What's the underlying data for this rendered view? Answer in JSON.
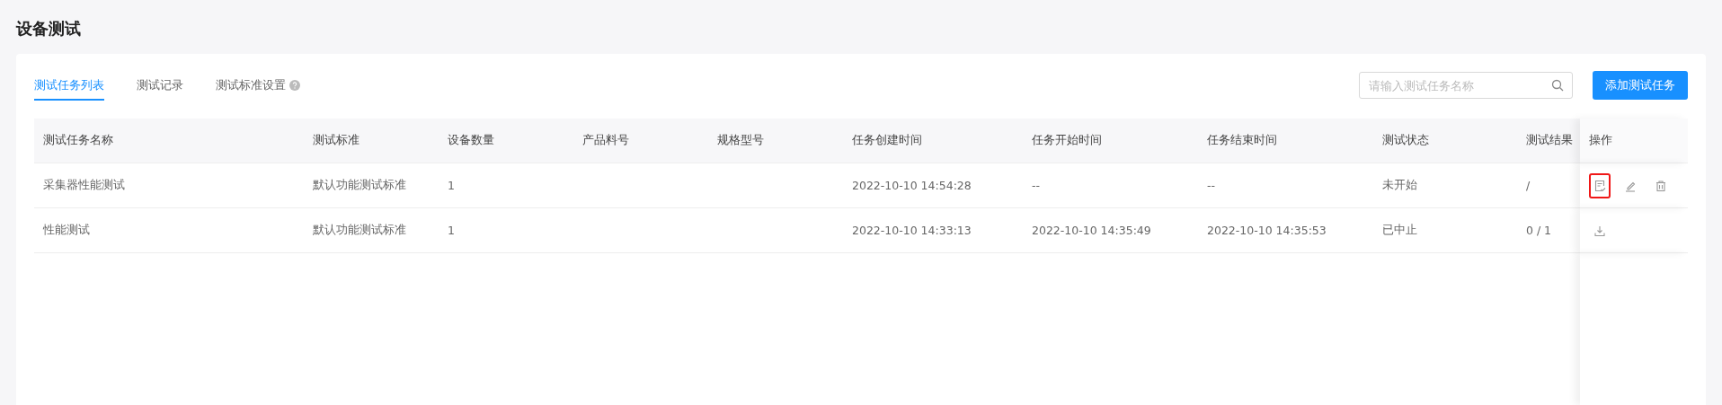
{
  "page_title": "设备测试",
  "tabs": [
    {
      "label": "测试任务列表",
      "selected": true,
      "help": false
    },
    {
      "label": "测试记录",
      "selected": false,
      "help": false
    },
    {
      "label": "测试标准设置",
      "selected": false,
      "help": true
    }
  ],
  "search": {
    "placeholder": "请输入测试任务名称"
  },
  "add_button": "添加测试任务",
  "table": {
    "columns": [
      "测试任务名称",
      "测试标准",
      "设备数量",
      "产品料号",
      "规格型号",
      "任务创建时间",
      "任务开始时间",
      "任务结束时间",
      "测试状态",
      "测试结果",
      "操作"
    ],
    "rows": [
      {
        "cells": [
          "采集器性能测试",
          "默认功能测试标准",
          "1",
          "",
          "",
          "2022-10-10 14:54:28",
          "--",
          "--",
          "未开始",
          "/"
        ],
        "actions": [
          {
            "kind": "report",
            "highlighted": true
          },
          {
            "kind": "edit",
            "highlighted": false
          },
          {
            "kind": "delete",
            "highlighted": false
          }
        ]
      },
      {
        "cells": [
          "性能测试",
          "默认功能测试标准",
          "1",
          "",
          "",
          "2022-10-10 14:33:13",
          "2022-10-10 14:35:49",
          "2022-10-10 14:35:53",
          "已中止",
          "0 / 1"
        ],
        "actions": [
          {
            "kind": "download",
            "highlighted": false
          }
        ]
      }
    ]
  }
}
